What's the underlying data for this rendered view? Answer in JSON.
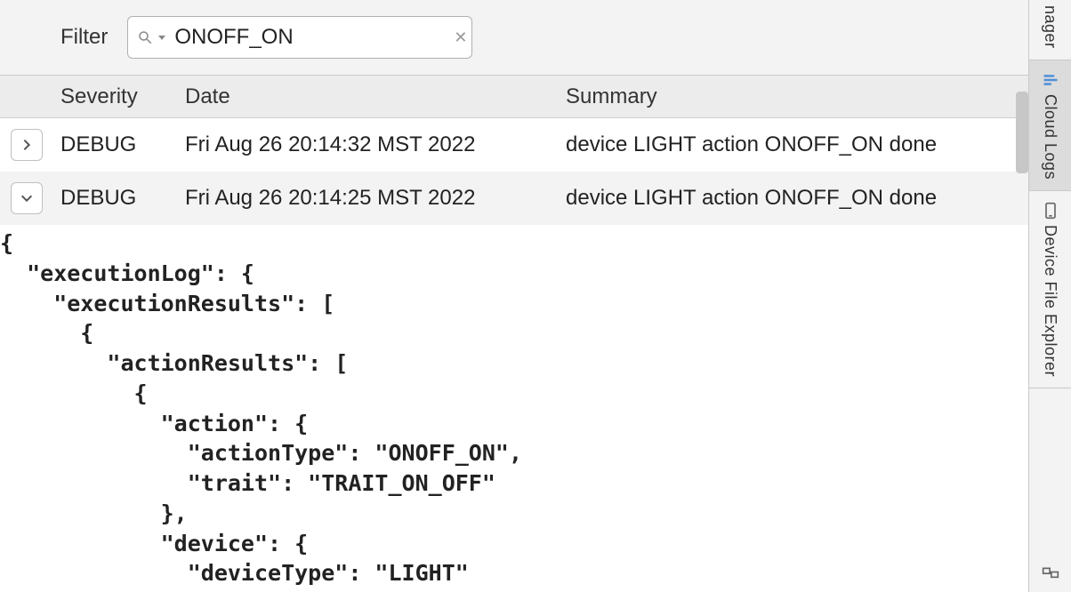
{
  "filter": {
    "label": "Filter",
    "value": "ONOFF_ON"
  },
  "columns": {
    "severity": "Severity",
    "date": "Date",
    "summary": "Summary"
  },
  "rows": [
    {
      "expanded": false,
      "severity": "DEBUG",
      "date": "Fri Aug 26 20:14:32 MST 2022",
      "summary": "device LIGHT action ONOFF_ON done"
    },
    {
      "expanded": true,
      "severity": "DEBUG",
      "date": "Fri Aug 26 20:14:25 MST 2022",
      "summary": "device LIGHT action ONOFF_ON done"
    }
  ],
  "detail_json": "{\n  \"executionLog\": {\n    \"executionResults\": [\n      {\n        \"actionResults\": [\n          {\n            \"action\": {\n              \"actionType\": \"ONOFF_ON\",\n              \"trait\": \"TRAIT_ON_OFF\"\n            },\n            \"device\": {\n              \"deviceType\": \"LIGHT\"",
  "sidebar": {
    "tabs": [
      {
        "id": "manager",
        "label": "Manager",
        "truncated": "nager",
        "active": false
      },
      {
        "id": "cloud-logs",
        "label": "Cloud Logs",
        "active": true
      },
      {
        "id": "device-file-explorer",
        "label": "Device File Explorer",
        "active": false
      }
    ]
  }
}
